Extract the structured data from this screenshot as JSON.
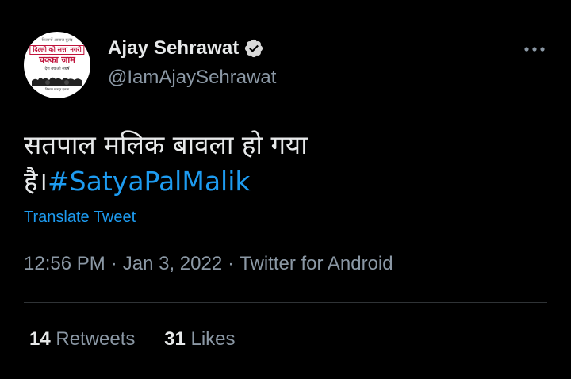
{
  "author": {
    "display_name": "Ajay Sehrawat",
    "handle": "@IamAjaySehrawat",
    "verified": true,
    "avatar": {
      "top_text": "किसानों आवाज बुलंद",
      "box_text": "दिल्ली को सत्ता नगरी",
      "big_text": "चक्का जाम",
      "small_text": "देश बचाओ संघर्ष",
      "foot_text": "किसान मजदूर एकता"
    }
  },
  "tweet": {
    "text_line1": "सतपाल मलिक बावला हो गया",
    "text_line2_prefix": "है।",
    "hashtag": "#SatyaPalMalik",
    "translate_label": "Translate Tweet",
    "time": "12:56 PM",
    "date": "Jan 3, 2022",
    "source": "Twitter for Android",
    "separator": "·"
  },
  "stats": {
    "retweets_count": "14",
    "retweets_label": "Retweets",
    "likes_count": "31",
    "likes_label": "Likes"
  },
  "icons": {
    "verified": "verified-badge-icon",
    "more": "more-options-icon"
  },
  "colors": {
    "background": "#000000",
    "text_primary": "#e7e9ea",
    "text_secondary": "#8b98a5",
    "link": "#1d9bf0",
    "divider": "#2f3336"
  }
}
